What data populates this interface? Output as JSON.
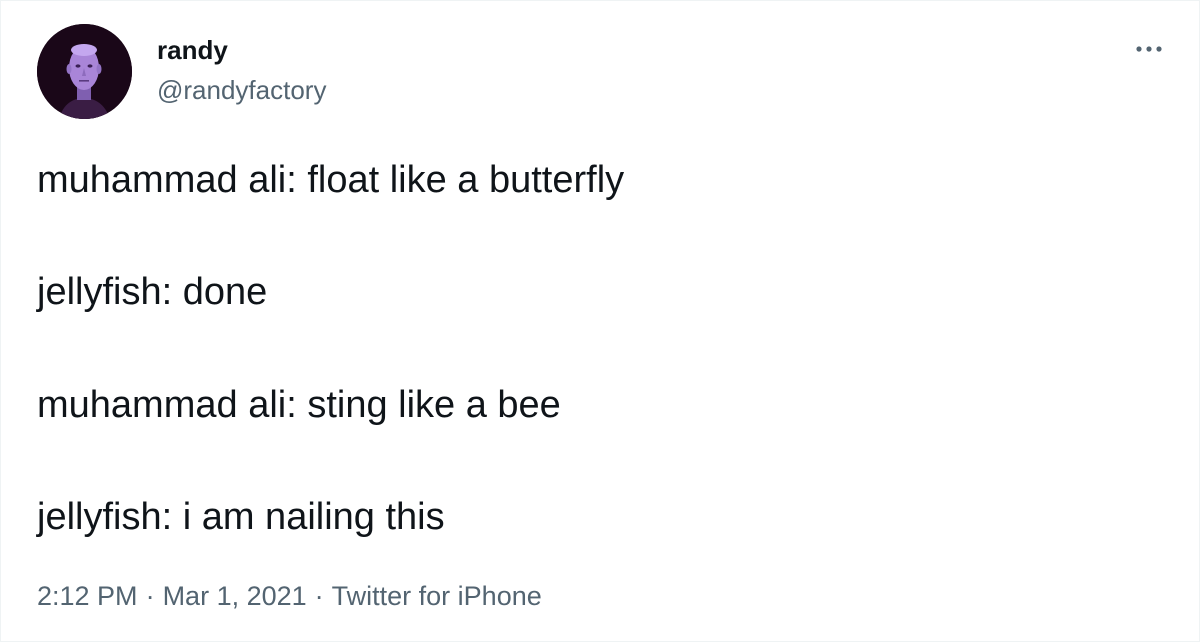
{
  "author": {
    "display_name": "randy",
    "handle": "@randyfactory",
    "avatar_icon": "purple-face-avatar",
    "avatar_bg": "#1a0718",
    "avatar_face_color": "#a985d8"
  },
  "more_icon": "more-horizontal-icon",
  "tweet": {
    "lines": [
      "muhammad ali: float like a butterfly",
      "jellyfish: done",
      "muhammad ali: sting like a bee",
      "jellyfish: i am nailing this"
    ]
  },
  "meta": {
    "time": "2:12 PM",
    "separator": "·",
    "date": "Mar 1, 2021",
    "source": "Twitter for iPhone"
  },
  "colors": {
    "text_primary": "#0f1419",
    "text_secondary": "#536471"
  }
}
